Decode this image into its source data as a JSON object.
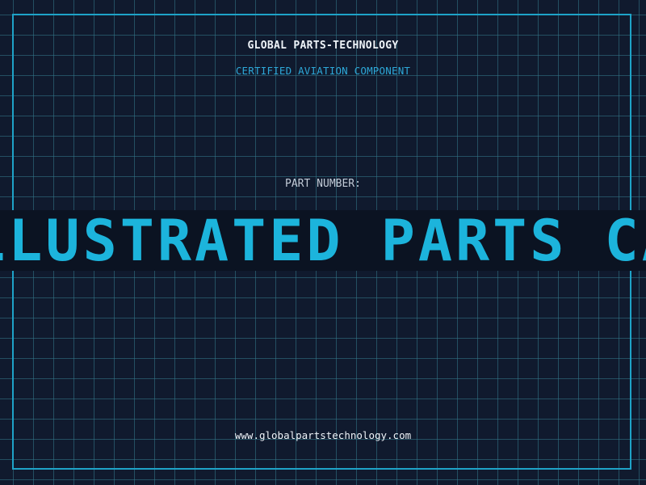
{
  "header": {
    "company_name": "GLOBAL PARTS-TECHNOLOGY",
    "certification": "CERTIFIED AVIATION COMPONENT"
  },
  "part": {
    "label": "PART NUMBER:"
  },
  "banner": {
    "text": "ILLUSTRATED PARTS CATALOG"
  },
  "footer": {
    "website": "www.globalpartstechnology.com"
  },
  "colors": {
    "background": "#101a2e",
    "grid": "#347a8c",
    "accent": "#1cb4dc",
    "banner_bg": "#0b1322"
  }
}
